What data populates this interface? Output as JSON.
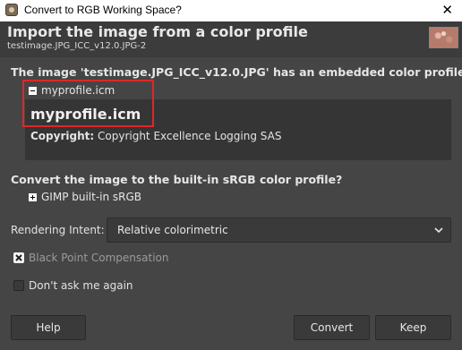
{
  "window": {
    "title": "Convert to RGB Working Space?",
    "close_glyph": "✕"
  },
  "header": {
    "title": "Import the image from a color profile",
    "subtitle": "testimage.JPG_ICC_v12.0.JPG-2"
  },
  "embedded": {
    "heading": "The image 'testimage.JPG_ICC_v12.0.JPG' has an embedded color profile",
    "expander_label": "myprofile.icm",
    "profile_name": "myprofile.icm",
    "copyright_label": "Copyright:",
    "copyright_value": "Copyright Excellence Logging SAS"
  },
  "convert": {
    "question": "Convert the image to the built-in sRGB color profile?",
    "expander_label": "GIMP built-in sRGB"
  },
  "rendering": {
    "label": "Rendering Intent:",
    "value": "Relative colorimetric"
  },
  "options": {
    "black_point": {
      "label": "Black Point Compensation",
      "checked": true,
      "enabled": false
    },
    "dont_ask": {
      "label": "Don't ask me again",
      "checked": false,
      "enabled": true
    }
  },
  "buttons": {
    "help": "Help",
    "convert": "Convert",
    "keep": "Keep"
  },
  "colors": {
    "background": "#454545",
    "highlight": "#e0262a"
  }
}
